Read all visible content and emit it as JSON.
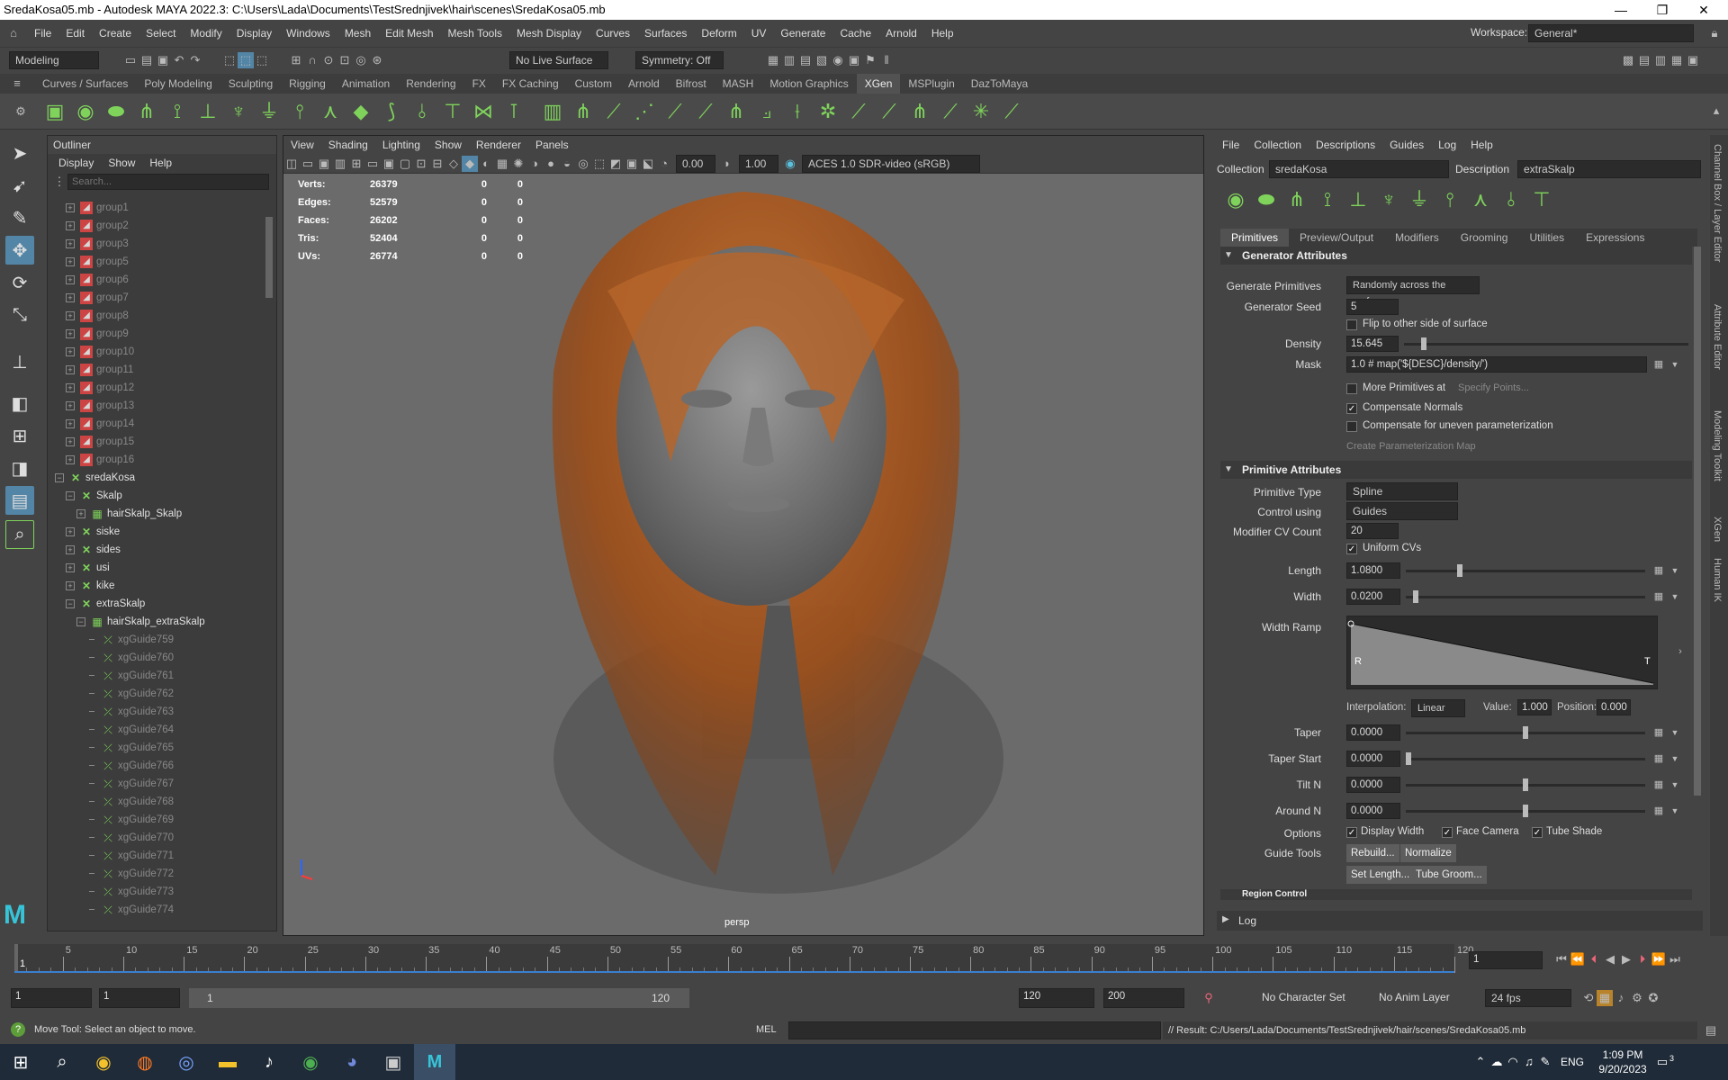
{
  "window": {
    "title": "SredaKosa05.mb - Autodesk MAYA 2022.3: C:\\Users\\Lada\\Documents\\TestSrednjivek\\hair\\scenes\\SredaKosa05.mb",
    "min": "—",
    "max": "❐",
    "close": "✕"
  },
  "menu": [
    "File",
    "Edit",
    "Create",
    "Select",
    "Modify",
    "Display",
    "Windows",
    "Mesh",
    "Edit Mesh",
    "Mesh Tools",
    "Mesh Display",
    "Curves",
    "Surfaces",
    "Deform",
    "UV",
    "Generate",
    "Cache",
    "Arnold",
    "Help"
  ],
  "workspace": {
    "label": "Workspace:",
    "value": "General*"
  },
  "statusline": {
    "mode": "Modeling",
    "live_surface": "No Live Surface",
    "symmetry": "Symmetry: Off"
  },
  "shelf_tabs": [
    "Curves / Surfaces",
    "Poly Modeling",
    "Sculpting",
    "Rigging",
    "Animation",
    "Rendering",
    "FX",
    "FX Caching",
    "Custom",
    "Arnold",
    "Bifrost",
    "MASH",
    "Motion Graphics",
    "XGen",
    "MSPlugin",
    "DazToMaya"
  ],
  "shelf_active": "XGen",
  "outliner": {
    "title": "Outliner",
    "menus": [
      "Display",
      "Show",
      "Help"
    ],
    "search_placeholder": "Search...",
    "rows": [
      {
        "label": "group1",
        "depth": 1,
        "type": "group",
        "exp": "+",
        "dim": true
      },
      {
        "label": "group2",
        "depth": 1,
        "type": "group",
        "exp": "+",
        "dim": true
      },
      {
        "label": "group3",
        "depth": 1,
        "type": "group",
        "exp": "+",
        "dim": true
      },
      {
        "label": "group5",
        "depth": 1,
        "type": "group",
        "exp": "+",
        "dim": true
      },
      {
        "label": "group6",
        "depth": 1,
        "type": "group",
        "exp": "+",
        "dim": true
      },
      {
        "label": "group7",
        "depth": 1,
        "type": "group",
        "exp": "+",
        "dim": true
      },
      {
        "label": "group8",
        "depth": 1,
        "type": "group",
        "exp": "+",
        "dim": true
      },
      {
        "label": "group9",
        "depth": 1,
        "type": "group",
        "exp": "+",
        "dim": true
      },
      {
        "label": "group10",
        "depth": 1,
        "type": "group",
        "exp": "+",
        "dim": true
      },
      {
        "label": "group11",
        "depth": 1,
        "type": "group",
        "exp": "+",
        "dim": true
      },
      {
        "label": "group12",
        "depth": 1,
        "type": "group",
        "exp": "+",
        "dim": true
      },
      {
        "label": "group13",
        "depth": 1,
        "type": "group",
        "exp": "+",
        "dim": true
      },
      {
        "label": "group14",
        "depth": 1,
        "type": "group",
        "exp": "+",
        "dim": true
      },
      {
        "label": "group15",
        "depth": 1,
        "type": "group",
        "exp": "+",
        "dim": true
      },
      {
        "label": "group16",
        "depth": 1,
        "type": "group",
        "exp": "+",
        "dim": true
      },
      {
        "label": "sredaKosa",
        "depth": 0,
        "type": "xgen",
        "exp": "−",
        "dim": false
      },
      {
        "label": "Skalp",
        "depth": 1,
        "type": "xgen",
        "exp": "−",
        "dim": false
      },
      {
        "label": "hairSkalp_Skalp",
        "depth": 2,
        "type": "desc",
        "exp": "+",
        "dim": false
      },
      {
        "label": "siske",
        "depth": 1,
        "type": "xgen",
        "exp": "+",
        "dim": false
      },
      {
        "label": "sides",
        "depth": 1,
        "type": "xgen",
        "exp": "+",
        "dim": false
      },
      {
        "label": "usi",
        "depth": 1,
        "type": "xgen",
        "exp": "+",
        "dim": false
      },
      {
        "label": "kike",
        "depth": 1,
        "type": "xgen",
        "exp": "+",
        "dim": false
      },
      {
        "label": "extraSkalp",
        "depth": 1,
        "type": "xgen",
        "exp": "−",
        "dim": false
      },
      {
        "label": "hairSkalp_extraSkalp",
        "depth": 2,
        "type": "desc",
        "exp": "−",
        "dim": false
      },
      {
        "label": "xgGuide759",
        "depth": 3,
        "type": "guide",
        "exp": "",
        "dim": true
      },
      {
        "label": "xgGuide760",
        "depth": 3,
        "type": "guide",
        "exp": "",
        "dim": true
      },
      {
        "label": "xgGuide761",
        "depth": 3,
        "type": "guide",
        "exp": "",
        "dim": true
      },
      {
        "label": "xgGuide762",
        "depth": 3,
        "type": "guide",
        "exp": "",
        "dim": true
      },
      {
        "label": "xgGuide763",
        "depth": 3,
        "type": "guide",
        "exp": "",
        "dim": true
      },
      {
        "label": "xgGuide764",
        "depth": 3,
        "type": "guide",
        "exp": "",
        "dim": true
      },
      {
        "label": "xgGuide765",
        "depth": 3,
        "type": "guide",
        "exp": "",
        "dim": true
      },
      {
        "label": "xgGuide766",
        "depth": 3,
        "type": "guide",
        "exp": "",
        "dim": true
      },
      {
        "label": "xgGuide767",
        "depth": 3,
        "type": "guide",
        "exp": "",
        "dim": true
      },
      {
        "label": "xgGuide768",
        "depth": 3,
        "type": "guide",
        "exp": "",
        "dim": true
      },
      {
        "label": "xgGuide769",
        "depth": 3,
        "type": "guide",
        "exp": "",
        "dim": true
      },
      {
        "label": "xgGuide770",
        "depth": 3,
        "type": "guide",
        "exp": "",
        "dim": true
      },
      {
        "label": "xgGuide771",
        "depth": 3,
        "type": "guide",
        "exp": "",
        "dim": true
      },
      {
        "label": "xgGuide772",
        "depth": 3,
        "type": "guide",
        "exp": "",
        "dim": true
      },
      {
        "label": "xgGuide773",
        "depth": 3,
        "type": "guide",
        "exp": "",
        "dim": true
      },
      {
        "label": "xgGuide774",
        "depth": 3,
        "type": "guide",
        "exp": "",
        "dim": true
      }
    ]
  },
  "viewport": {
    "menus": [
      "View",
      "Shading",
      "Lighting",
      "Show",
      "Renderer",
      "Panels"
    ],
    "exposure": "0.00",
    "gamma": "1.00",
    "colorspace": "ACES 1.0 SDR-video (sRGB)",
    "camera": "persp",
    "hud": [
      {
        "label": "Verts:",
        "a": "26379",
        "b": "0",
        "c": "0"
      },
      {
        "label": "Edges:",
        "a": "52579",
        "b": "0",
        "c": "0"
      },
      {
        "label": "Faces:",
        "a": "26202",
        "b": "0",
        "c": "0"
      },
      {
        "label": "Tris:",
        "a": "52404",
        "b": "0",
        "c": "0"
      },
      {
        "label": "UVs:",
        "a": "26774",
        "b": "0",
        "c": "0"
      }
    ]
  },
  "xgen": {
    "menus": [
      "File",
      "Collection",
      "Descriptions",
      "Guides",
      "Log",
      "Help"
    ],
    "collection_label": "Collection",
    "collection": "sredaKosa",
    "description_label": "Description",
    "description": "extraSkalp",
    "tabs": [
      "Primitives",
      "Preview/Output",
      "Modifiers",
      "Grooming",
      "Utilities",
      "Expressions"
    ],
    "tab_active": "Primitives",
    "gen_section": "Generator Attributes",
    "generate_primitives_label": "Generate Primitives",
    "generate_primitives": "Randomly across the surface",
    "seed_label": "Generator Seed",
    "seed": "5",
    "flip_label": "Flip to other side of surface",
    "density_label": "Density",
    "density": "15.645",
    "density_frac": 0.06,
    "mask_label": "Mask",
    "mask": "1.0 # map('${DESC}/density/')",
    "more_prims_label": "More Primitives at",
    "specify_points": "Specify Points...",
    "comp_normals_label": "Compensate Normals",
    "comp_uneven_label": "Compensate for uneven parameterization",
    "create_param_map": "Create Parameterization Map",
    "prim_section": "Primitive Attributes",
    "prim_type_label": "Primitive Type",
    "prim_type": "Spline",
    "control_label": "Control using",
    "control": "Guides",
    "cv_label": "Modifier CV Count",
    "cv": "20",
    "uniform_label": "Uniform CVs",
    "length_label": "Length",
    "length": "1.0800",
    "length_frac": 0.22,
    "width_label": "Width",
    "width": "0.0200",
    "width_frac": 0.03,
    "ramp_label": "Width Ramp",
    "ramp_r": "R",
    "ramp_t": "T",
    "interp_label": "Interpolation:",
    "interp": "Linear",
    "value_label": "Value:",
    "value": "1.000",
    "position_label": "Position:",
    "position": "0.000",
    "taper_label": "Taper",
    "taper": "0.0000",
    "taper_frac": 0.5,
    "taper_start_label": "Taper Start",
    "taper_start": "0.0000",
    "taper_start_frac": 0.0,
    "tilt_label": "Tilt N",
    "tilt": "0.0000",
    "tilt_frac": 0.5,
    "around_label": "Around N",
    "around": "0.0000",
    "around_frac": 0.5,
    "options_label": "Options",
    "opt_display_width": "Display Width",
    "opt_face_camera": "Face Camera",
    "opt_tube_shade": "Tube Shade",
    "guide_tools_label": "Guide Tools",
    "rebuild": "Rebuild...",
    "normalize": "Normalize",
    "set_length": "Set Length...",
    "tube_groom": "Tube Groom...",
    "region_section": "Region Control",
    "log_label": "Log"
  },
  "side_tabs": [
    "Channel Box / Layer Editor",
    "Attribute Editor",
    "Modeling Toolkit",
    "XGen",
    "Human IK"
  ],
  "timeline": {
    "ticks": [
      "5",
      "10",
      "15",
      "20",
      "25",
      "30",
      "35",
      "40",
      "45",
      "50",
      "55",
      "60",
      "65",
      "70",
      "75",
      "80",
      "85",
      "90",
      "95",
      "100",
      "105",
      "110",
      "115",
      "120"
    ],
    "current_frame": "1",
    "frame_field": "1",
    "playhead_label": "1"
  },
  "range": {
    "start": "1",
    "start2": "1",
    "slider_start": "1",
    "slider_end": "120",
    "end": "120",
    "end2": "200",
    "char_set": "No Character Set",
    "anim_layer": "No Anim Layer",
    "fps": "24 fps"
  },
  "cmd": {
    "help": "Move Tool: Select an object to move.",
    "lang": "MEL",
    "result": "// Result: C:/Users/Lada/Documents/TestSrednjivek/hair/scenes/SredaKosa05.mb"
  },
  "taskbar": {
    "time": "1:09 PM",
    "date": "9/20/2023",
    "lang": "ENG",
    "notif": "3"
  }
}
